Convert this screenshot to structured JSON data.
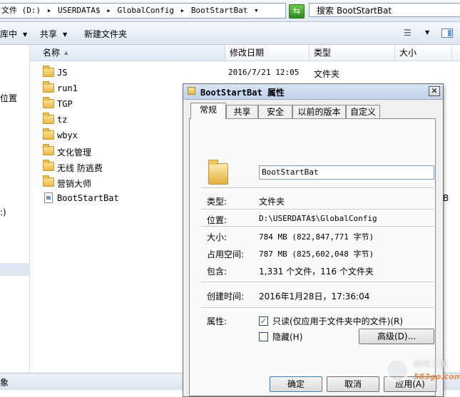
{
  "address_bar": {
    "path_segments": [
      "文件 (D:)",
      "USERDATA$",
      "GlobalConfig",
      "BootStartBat"
    ],
    "search_placeholder": "搜索 BootStartBat"
  },
  "toolbar": {
    "organize_label": "库中",
    "share_label": "共享",
    "new_folder_label": "新建文件夹"
  },
  "nav_pane": {
    "items": [
      "位置",
      ":)"
    ]
  },
  "columns": {
    "name": "名称",
    "date": "修改日期",
    "type": "类型",
    "size": "大小"
  },
  "files": [
    {
      "name": "JS",
      "date": "2016/7/21 12:05",
      "type": "文件夹",
      "icon": "folder-icon"
    },
    {
      "name": "run1",
      "date": "",
      "type": "",
      "icon": "folder-icon"
    },
    {
      "name": "TGP",
      "date": "",
      "type": "",
      "icon": "folder-icon"
    },
    {
      "name": "tz",
      "date": "",
      "type": "",
      "icon": "folder-icon"
    },
    {
      "name": "wbyx",
      "date": "",
      "type": "",
      "icon": "folder-icon"
    },
    {
      "name": "文化管理",
      "date": "",
      "type": "",
      "icon": "folder-icon"
    },
    {
      "name": "无线 防逃费",
      "date": "",
      "type": "",
      "icon": "folder-icon"
    },
    {
      "name": "营销大师",
      "date": "",
      "type": "",
      "icon": "folder-icon"
    },
    {
      "name": "BootStartBat",
      "date": "",
      "type": "",
      "icon": "file-icon"
    }
  ],
  "partial_size_glyph": "B",
  "status_bar": {
    "text": "象"
  },
  "dialog": {
    "title": "BootStartBat 属性",
    "close_glyph": "✕",
    "tabs": [
      "常规",
      "共享",
      "安全",
      "以前的版本",
      "自定义"
    ],
    "active_tab": "常规",
    "name_value": "BootStartBat",
    "props": {
      "type_label": "类型:",
      "type_value": "文件夹",
      "location_label": "位置:",
      "location_value": "D:\\USERDATA$\\GlobalConfig",
      "size_label": "大小:",
      "size_value": "784 MB (822,847,771 字节)",
      "size_on_disk_label": "占用空间:",
      "size_on_disk_value": "787 MB (825,602,048 字节)",
      "contains_label": "包含:",
      "contains_value": "1,331 个文件，116 个文件夹",
      "created_label": "创建时间:",
      "created_value": "2016年1月28日，17:36:04",
      "attributes_label": "属性:"
    },
    "readonly_label": "只读(仅应用于文件夹中的文件)(R)",
    "readonly_checked": true,
    "hidden_label": "隐藏(H)",
    "hidden_checked": false,
    "advanced_label": "高级(D)...",
    "ok_label": "确定",
    "cancel_label": "取消",
    "apply_label": "应用(A)"
  },
  "watermark": {
    "line1": "网吧三国",
    "line2": "583go.com"
  },
  "colors": {
    "accent": "#3c7fb1",
    "folder": "#e9b84a",
    "refresh_green": "#2d8d1d",
    "watermark_orange": "#e46c1e"
  }
}
